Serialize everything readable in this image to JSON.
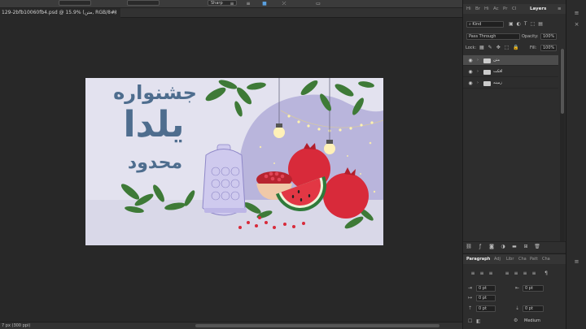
{
  "options_bar": {
    "style_value": "Sharp"
  },
  "document_tab": {
    "title": "129-2bfb10060fb4.psd @ 15.9% (متن, RGB/8#)",
    "close": "×"
  },
  "status_bar": {
    "text": "7 px (300 ppi)"
  },
  "panel_tabs": [
    "Hi",
    "Br",
    "Hi",
    "Ac",
    "Pr",
    "Cl",
    "Layers"
  ],
  "layers_panel": {
    "kind": "Kind",
    "blend_mode": "Pass Through",
    "opacity_label": "Opacity:",
    "opacity_value": "100%",
    "lock_label": "Lock:",
    "fill_label": "Fill:",
    "fill_value": "100%",
    "layers": [
      {
        "name": "متن",
        "selected": true
      },
      {
        "name": "افکت",
        "selected": false
      },
      {
        "name": "زمینه",
        "selected": false
      }
    ]
  },
  "paragraph_panel": {
    "tabs": [
      "Paragraph",
      "Adj",
      "Libr",
      "Cha",
      "Patt",
      "Cha"
    ],
    "indent_left": "0 pt",
    "indent_right": "0 pt",
    "indent_first": "0 pt",
    "space_before": "0 pt",
    "space_after": "0 pt",
    "space_after2": "0 pt",
    "hyphenation": "Medium"
  },
  "artwork": {
    "line1": "جشنواره",
    "line2": "یلدا",
    "line3": "محدود",
    "colors": {
      "text": "#4e6d8e",
      "bg": "#e3e2ef",
      "blob": "#b9b5dc",
      "pomegranate": "#d82a3a",
      "leaf": "#3e7a37"
    }
  }
}
